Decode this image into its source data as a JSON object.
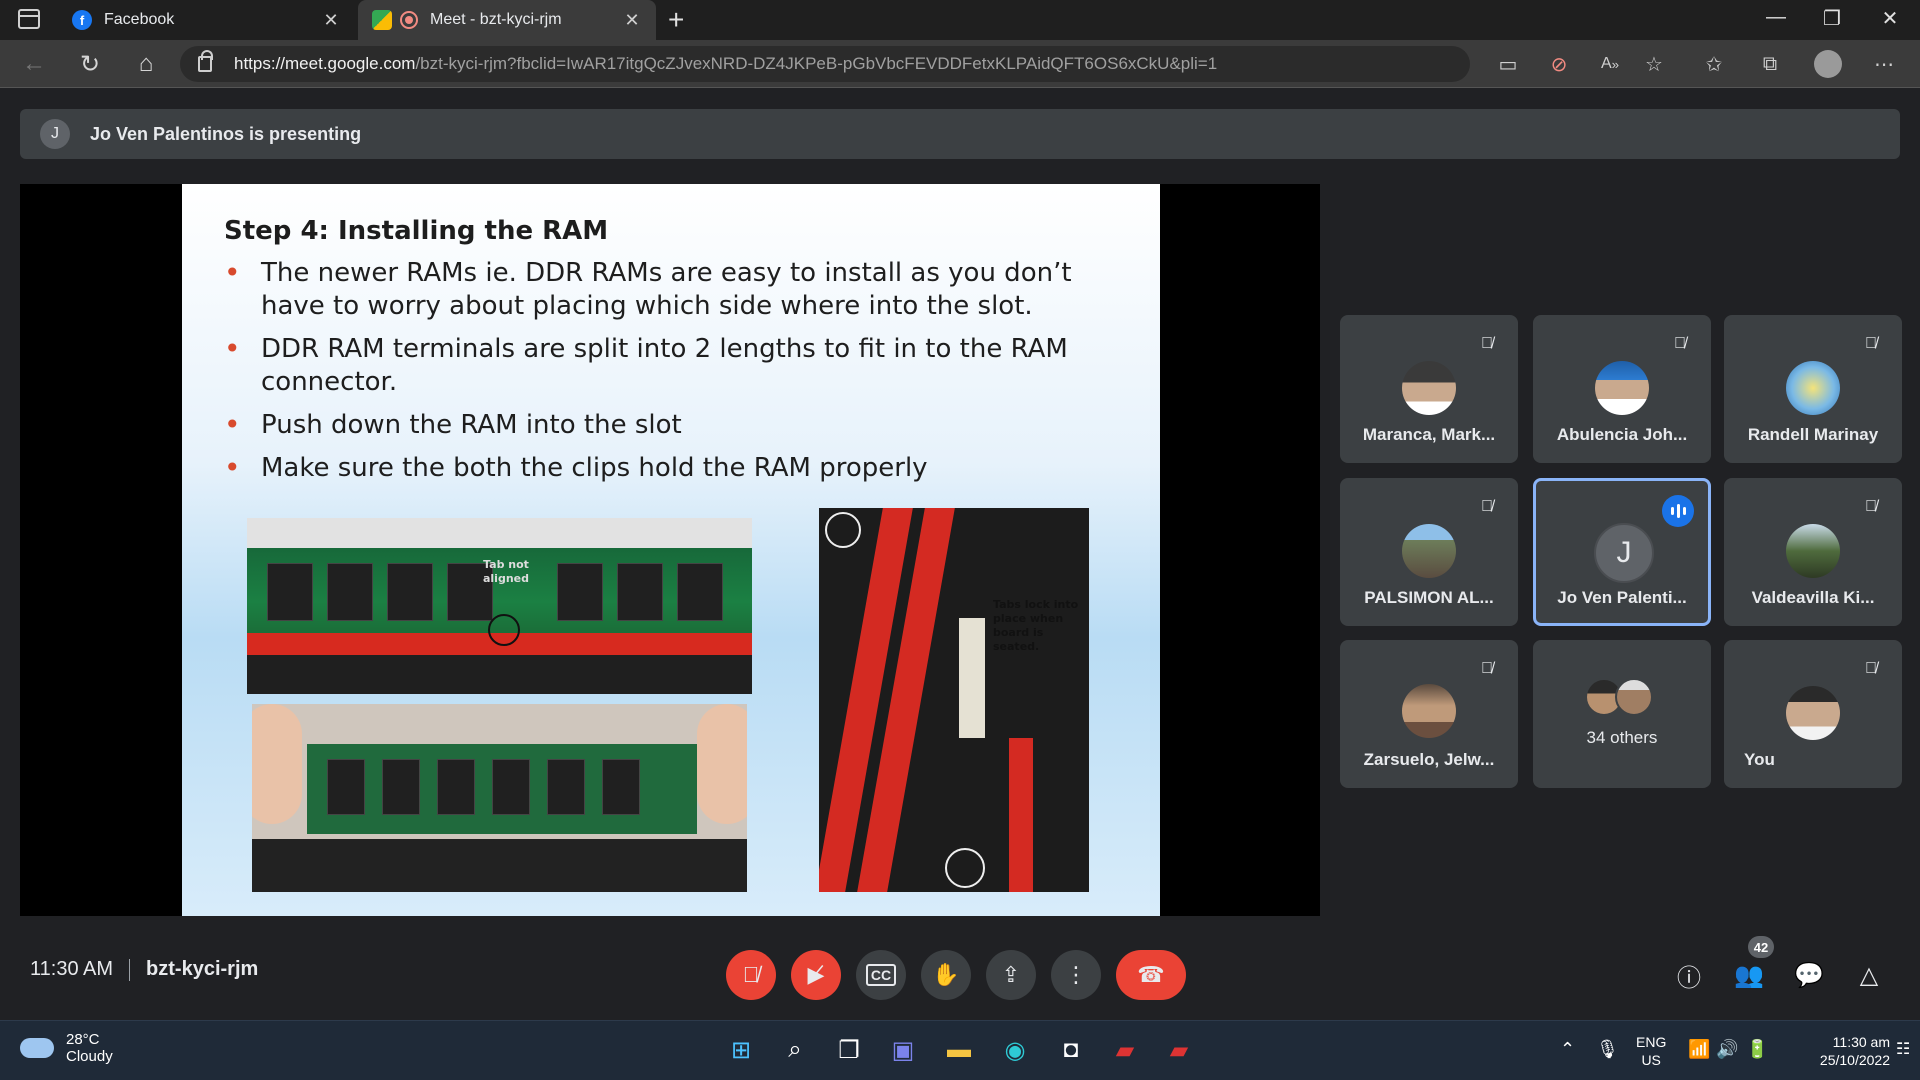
{
  "browser": {
    "tabs": [
      {
        "title": "Facebook",
        "icon": "facebook-icon",
        "color": "#1877f2"
      },
      {
        "title": "Meet - bzt-kyci-rjm",
        "icon": "meet-icon",
        "recording": true
      }
    ],
    "url_host": "https://meet.google.com",
    "url_path": "/bzt-kyci-rjm?fbclid=IwAR17itgQcZJvexNRD-DZ4JKPeB-pGbVbcFEVDDFetxKLPAidQFT6OS6xCkU&pli=1"
  },
  "presenting": {
    "initial": "J",
    "text": "Jo Ven Palentinos is presenting"
  },
  "slide": {
    "title": "Step 4: Installing the RAM",
    "bullets": [
      "The newer RAMs ie. DDR RAMs are easy to install as you don’t have to worry about placing which side where into the slot.",
      "DDR RAM terminals are split into 2 lengths to fit in to the RAM connector.",
      "Push down the RAM into the slot",
      "Make sure the both the clips hold the RAM properly"
    ],
    "photo1_label": "Tab not aligned",
    "photo3_label": "Tabs lock into place when board is seated."
  },
  "participants": [
    {
      "name": "Maranca, Mark...",
      "muted": true
    },
    {
      "name": "Abulencia Joh...",
      "muted": true
    },
    {
      "name": "Randell Marinay",
      "muted": true
    },
    {
      "name": "PALSIMON AL...",
      "muted": true
    },
    {
      "name": "Jo Ven Palenti...",
      "initial": "J",
      "speaking": true
    },
    {
      "name": "Valdeavilla Ki...",
      "muted": true
    },
    {
      "name": "Zarsuelo, Jelw...",
      "muted": true
    },
    {
      "name": "34 others"
    },
    {
      "name": "You",
      "muted": true
    }
  ],
  "meeting": {
    "time": "11:30 AM",
    "code": "bzt-kyci-rjm",
    "people_count": "42"
  },
  "taskbar": {
    "temp": "28°C",
    "weather": "Cloudy",
    "lang": "ENG",
    "region": "US",
    "clock_time": "11:30 am",
    "clock_date": "25/10/2022"
  },
  "colors": {
    "meet_red": "#ea4335",
    "speaking_blue": "#8ab4f8",
    "tile_bg": "#3c4043"
  }
}
